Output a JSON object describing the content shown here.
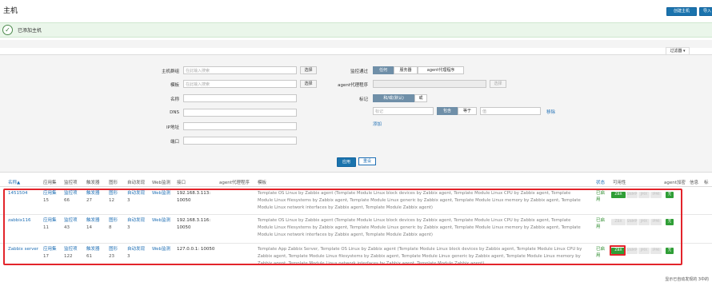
{
  "header": {
    "title": "主机",
    "btn_create": "创建主机",
    "btn_import": "导入"
  },
  "message": {
    "text": "已添加主机"
  },
  "filter": {
    "tab_label": "过滤器",
    "hostgroup_label": "主机群组",
    "hostgroup_placeholder": "在此输入搜索",
    "template_label": "模板",
    "template_placeholder": "在此输入搜索",
    "select_label": "选择",
    "name_label": "名称",
    "dns_label": "DNS",
    "ip_label": "IP地址",
    "port_label": "端口",
    "monitored_by_label": "监控通过",
    "monitored_by_options": [
      "任何",
      "服务器",
      "agent代理程序"
    ],
    "proxy_label": "agent代理程序",
    "tags_label": "标记",
    "tags_options": [
      "和/或(默认)",
      "或"
    ],
    "tag_placeholder": "标记",
    "value_placeholder": "值",
    "tag_op_options": [
      "包含",
      "等于"
    ],
    "remove_label": "移除",
    "add_label": "添加",
    "apply_label": "应用",
    "reset_label": "重设"
  },
  "table": {
    "columns": [
      "名称▲",
      "应用集",
      "监控项",
      "触发器",
      "图形",
      "自动发现",
      "Web监测",
      "接口",
      "agent代理程序",
      "模板",
      "状态",
      "可用性",
      "agent加密",
      "信息",
      "标"
    ],
    "rows": [
      {
        "name": "1451504",
        "apps": "应用集",
        "apps_n": "15",
        "items": "监控项",
        "items_n": "66",
        "triggers": "触发器",
        "triggers_n": "27",
        "graphs": "图形",
        "graphs_n": "12",
        "discovery": "自动发现",
        "discovery_n": "3",
        "web": "Web监测",
        "iface": "192.168.3.113:",
        "iface2": "10050",
        "templates": "Template OS Linux by Zabbix agent (Template Module Linux block devices by Zabbix agent, Template Module Linux CPU by Zabbix agent, Template Module Linux filesystems by Zabbix agent, Template Module Linux generic by Zabbix agent, Template Module Linux memory by Zabbix agent, Template Module Linux network interfaces by Zabbix agent, Template Module Zabbix agent)",
        "status": "已启用",
        "zbx_on": true,
        "enc": "无"
      },
      {
        "name": "zabbix116",
        "apps": "应用集",
        "apps_n": "11",
        "items": "监控项",
        "items_n": "43",
        "triggers": "触发器",
        "triggers_n": "14",
        "graphs": "图形",
        "graphs_n": "8",
        "discovery": "自动发现",
        "discovery_n": "3",
        "web": "Web监测",
        "iface": "192.168.3.116:",
        "iface2": "10050",
        "templates": "Template OS Linux by Zabbix agent (Template Module Linux block devices by Zabbix agent, Template Module Linux CPU by Zabbix agent, Template Module Linux filesystems by Zabbix agent, Template Module Linux generic by Zabbix agent, Template Module Linux memory by Zabbix agent, Template Module Linux network interfaces by Zabbix agent, Template Module Zabbix agent)",
        "status": "已启用",
        "zbx_on": false,
        "enc": "无"
      },
      {
        "name": "Zabbix server",
        "apps": "应用集",
        "apps_n": "17",
        "items": "监控项",
        "items_n": "122",
        "triggers": "触发器",
        "triggers_n": "61",
        "graphs": "图形",
        "graphs_n": "23",
        "discovery": "自动发现",
        "discovery_n": "3",
        "web": "Web监测",
        "iface": "127.0.0.1: 10050",
        "iface2": "",
        "templates": "Template App Zabbix Server, Template OS Linux by Zabbix agent (Template Module Linux block devices by Zabbix agent, Template Module Linux CPU by Zabbix agent, Template Module Linux filesystems by Zabbix agent, Template Module Linux generic by Zabbix agent, Template Module Linux memory by Zabbix agent, Template Module Linux network interfaces by Zabbix agent, Template Module Zabbix agent)",
        "status": "已启用",
        "zbx_on": true,
        "enc": "无"
      }
    ],
    "avail_labels": [
      "ZBX",
      "SNMP",
      "JMX",
      "IPMI"
    ]
  },
  "footer": {
    "text": "显示已自动发现的 3中的"
  }
}
